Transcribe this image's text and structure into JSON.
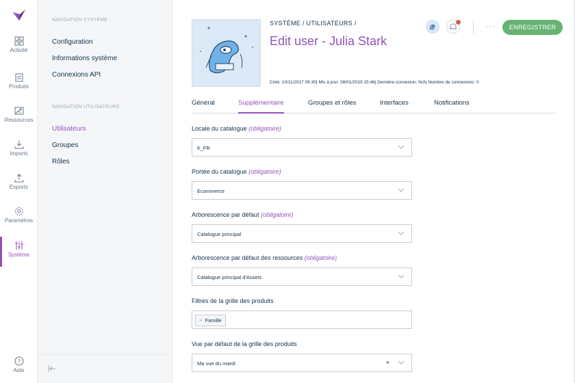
{
  "rail": {
    "items": [
      {
        "label": "Activité",
        "icon": "activity-icon"
      },
      {
        "label": "Produits",
        "icon": "products-icon"
      },
      {
        "label": "Ressources",
        "icon": "assets-icon"
      },
      {
        "label": "Imports",
        "icon": "imports-icon"
      },
      {
        "label": "Exports",
        "icon": "exports-icon"
      },
      {
        "label": "Paramètres",
        "icon": "settings-icon"
      },
      {
        "label": "Système",
        "icon": "system-icon"
      }
    ],
    "help": "Aide"
  },
  "panel": {
    "section1": "NAVIGATION SYSTÈME",
    "links1": [
      "Configuration",
      "Informations système",
      "Connexions API"
    ],
    "section2": "NAVIGATION UTILISATEURS",
    "links2": [
      "Utilisateurs",
      "Groupes",
      "Rôles"
    ]
  },
  "header": {
    "breadcrumb_1": "SYSTÈME",
    "breadcrumb_2": "UTILISATEURS",
    "sep": "/",
    "title": "Edit user - Julia Stark",
    "meta": "Créé: 10/11/2017 09:30| Mis à jour: 08/01/2019 15:46| Dernière connexion: N/A| Nombre de connexions: 0",
    "more": "···",
    "save": "ENREGISTRER"
  },
  "tabs": [
    "Général",
    "Supplémentaire",
    "Groupes et rôles",
    "Interfaces",
    "Notifications"
  ],
  "required_text": "(obligatoire)",
  "fields": {
    "catalog_locale": {
      "label": "Locale du catalogue",
      "value": "fr_FR"
    },
    "catalog_scope": {
      "label": "Portée du catalogue",
      "value": "Ecommerce"
    },
    "default_tree": {
      "label": "Arborescence par défaut",
      "value": "Catalogue principal"
    },
    "asset_tree": {
      "label": "Arborescence par défaut des ressources",
      "value": "Catalogue principal d'Assets"
    },
    "grid_filters": {
      "label": "Filtres de la grille des produits",
      "tag": "Famille",
      "tag_remove": "×"
    },
    "grid_view": {
      "label": "Vue par défaut de la grille des produits",
      "value": "Ma vue du mardi",
      "clear": "×"
    }
  },
  "colors": {
    "accent": "#9452ba",
    "save": "#67b373",
    "text": "#11324d",
    "muted": "#67768a",
    "notification": "#d4604f"
  }
}
